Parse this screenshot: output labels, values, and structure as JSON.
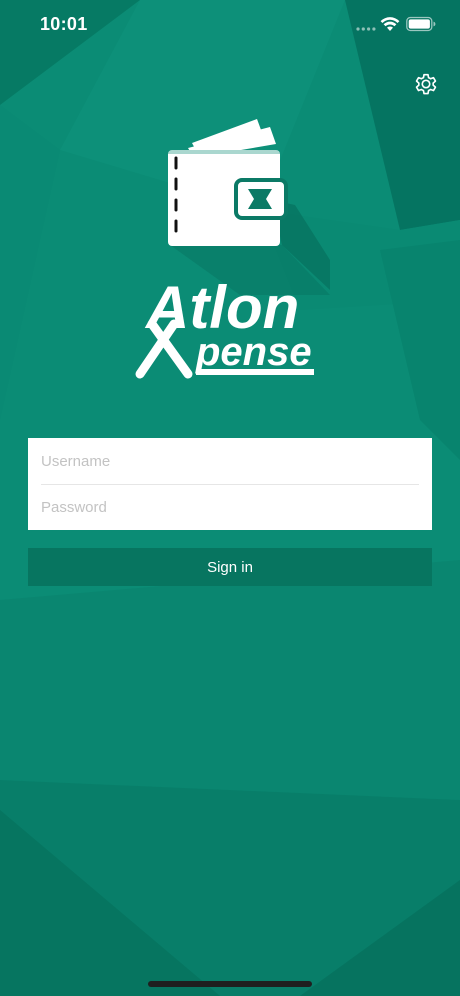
{
  "status_bar": {
    "time": "10:01",
    "signal_icon": "cellular-dots-icon",
    "wifi_icon": "wifi-icon",
    "battery_icon": "battery-icon"
  },
  "header": {
    "settings_icon": "gear-icon"
  },
  "logo": {
    "icon": "wallet-icon",
    "brand_line1": "Atlon",
    "brand_line2": "pense"
  },
  "login_form": {
    "username_placeholder": "Username",
    "username_value": "",
    "password_placeholder": "Password",
    "password_value": "",
    "sign_in_label": "Sign in"
  },
  "colors": {
    "background": "#0a8b74",
    "button": "#077560",
    "card": "#ffffff",
    "placeholder": "#c3c3c3"
  }
}
